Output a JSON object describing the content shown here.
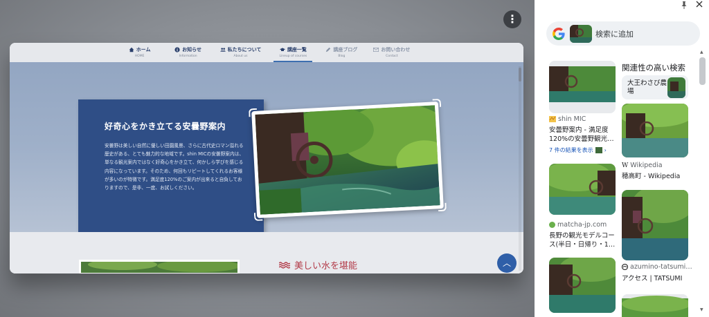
{
  "page": {
    "more_button_glyph": "⋮",
    "nav": [
      {
        "label": "ホーム",
        "sub": "HOME"
      },
      {
        "label": "お知らせ",
        "sub": "Information"
      },
      {
        "label": "私たちについて",
        "sub": "About us"
      },
      {
        "label": "講座一覧",
        "sub": "Lineup of courses"
      },
      {
        "label": "講座ブログ",
        "sub": "Blog"
      },
      {
        "label": "お問い合わせ",
        "sub": "Contact"
      }
    ],
    "info_title": "好奇心をかき立てる安曇野案内",
    "info_text": "安曇野は美しい自然に優しい田園風景、さらに古代史ロマン溢れる歴史がある、とても魅力的な地域です。shin MICの安曇野案内は、単なる観光案内ではなく好奇心をかき立て、何かしら学びを感じる内容になっています。そのため、何回もリピートしてくれるお客様が多いのが特徴です。満足度120%のご案内が出来ると自負しておりますので、是非、一度、お試しください。",
    "section_title": "美しい水を堪能",
    "scroll_top_glyph": "︿"
  },
  "panel": {
    "search_label": "検索に追加",
    "related_title": "関連性の高い検索",
    "chip_label": "大王わさび農場",
    "results": [
      {
        "source": "shin MIC",
        "title": "安曇野案内 - 満足度120%の安曇野観光…",
        "more": "7 件の結果を表示"
      },
      {
        "source": "Wikipedia",
        "title": "穂高町 - Wikipedia"
      },
      {
        "source": "matcha-jp.com",
        "title": "長野の観光モデルコース(半日・日帰り・1…"
      },
      {
        "source": "azumino-tatsumi…",
        "title": "アクセス | TATSUMI"
      }
    ]
  },
  "colors": {
    "accent_blue": "#2f4e86",
    "section_red": "#b23a48",
    "link_blue": "#1a56b8"
  }
}
